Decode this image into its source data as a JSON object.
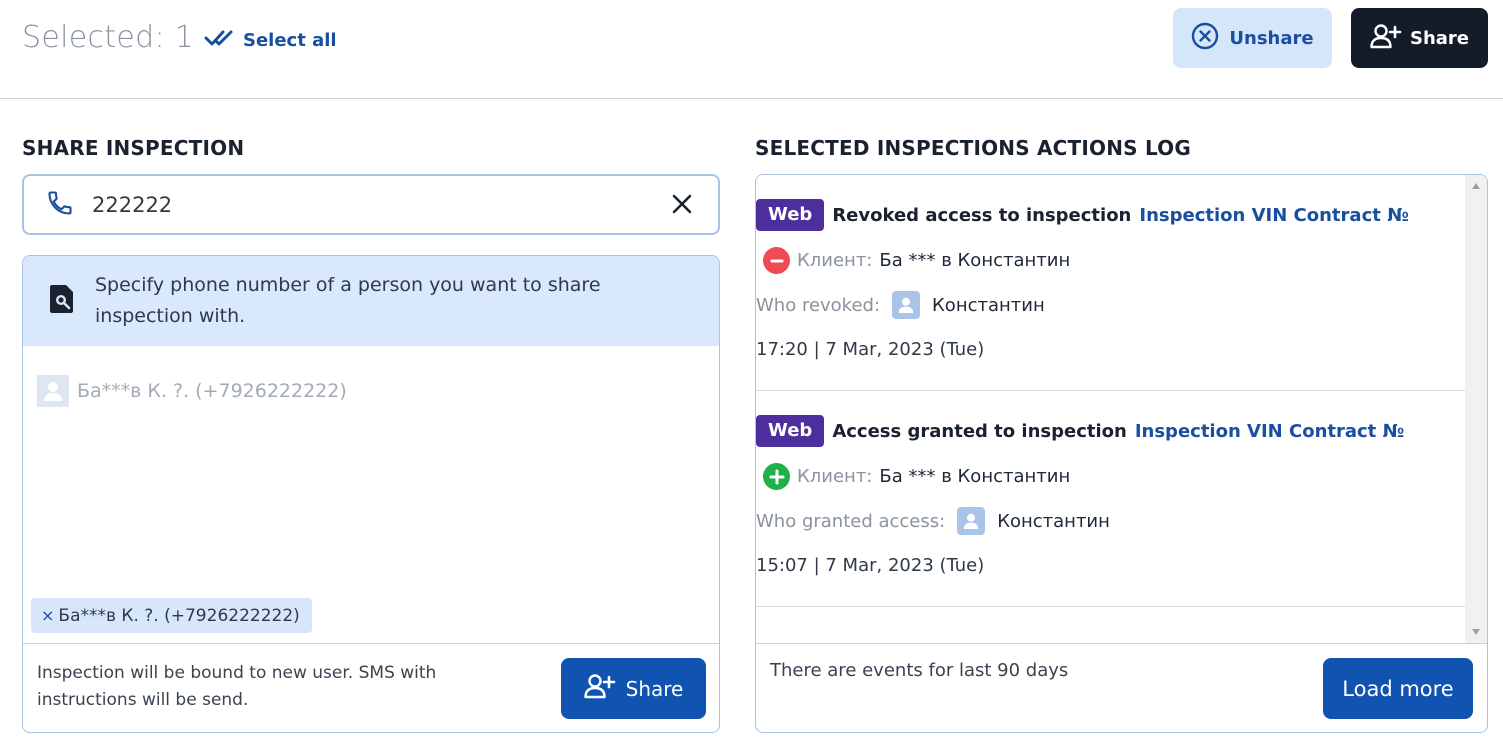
{
  "header": {
    "selected_label": "Selected: 1",
    "select_all_label": "Select all",
    "unshare_label": "Unshare",
    "share_label": "Share"
  },
  "share_panel": {
    "title": "SHARE INSPECTION",
    "phone_value": "222222",
    "hint": "Specify phone number of a person you want to share inspection with.",
    "candidate": "Ба***в К. ?. (+7926222222)",
    "chip_label": "Ба***в К. ?. (+7926222222)",
    "chip_remove": "×",
    "footer_note": "Inspection will be bound to new user. SMS with instructions will be send.",
    "share_button": "Share"
  },
  "log_panel": {
    "title": "SELECTED INSPECTIONS ACTIONS LOG",
    "entries": [
      {
        "source": "Web",
        "action": "Revoked access to inspection",
        "link": "Inspection VIN Contract №",
        "status": "revoked",
        "client_label": "Клиент:",
        "client_name": "Ба *** в Константин",
        "who_label": "Who revoked:",
        "who_name": "Константин",
        "time": "17:20 | 7 Mar, 2023 (Tue)"
      },
      {
        "source": "Web",
        "action": "Access granted to inspection",
        "link": "Inspection VIN Contract №",
        "status": "granted",
        "client_label": "Клиент:",
        "client_name": "Ба *** в Константин",
        "who_label": "Who granted access:",
        "who_name": "Константин",
        "time": "15:07 | 7 Mar, 2023 (Tue)"
      }
    ],
    "events_note": "There are events for last 90 days",
    "load_more": "Load more"
  },
  "colors": {
    "accent": "#1053b0",
    "link": "#1a4fa0",
    "dark_button": "#141c2a",
    "light_button": "#d6e6fa",
    "web_badge": "#4c2f9c",
    "revoked": "#ef4a55",
    "granted": "#20b04b"
  },
  "icons": [
    "double-check-icon",
    "close-circle-icon",
    "add-user-icon",
    "phone-icon",
    "close-icon",
    "search-document-icon",
    "user-avatar-icon",
    "minus-circle-icon",
    "plus-circle-icon"
  ]
}
